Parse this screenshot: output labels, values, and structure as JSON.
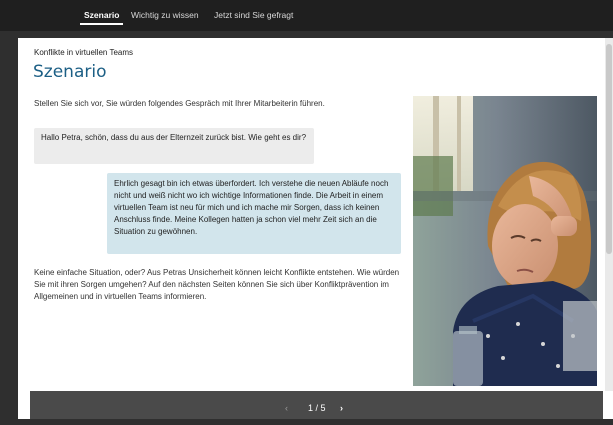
{
  "nav": {
    "tabs": [
      {
        "label": "Szenario",
        "active": true
      },
      {
        "label": "Wichtig zu wissen",
        "active": false
      },
      {
        "label": "Jetzt sind Sie gefragt",
        "active": false
      }
    ]
  },
  "page": {
    "kicker": "Konflikte in virtuellen Teams",
    "title": "Szenario",
    "intro": "Stellen Sie sich vor, Sie würden folgendes Gespräch mit Ihrer Mitarbeiterin führen.",
    "bubble_manager": "Hallo Petra, schön, dass du aus der Elternzeit zurück bist. Wie geht es dir?",
    "bubble_petra": "Ehrlich gesagt bin ich etwas überfordert. Ich verstehe die neuen Abläufe noch nicht und weiß nicht wo ich wichtige Informationen finde. Die Arbeit in einem virtuellen Team ist neu für mich und ich mache mir Sorgen, dass ich keinen Anschluss finde. Meine Kollegen hatten ja schon viel mehr Zeit sich an die Situation zu gewöhnen.",
    "outro": "Keine einfache Situation, oder? Aus Petras Unsicherheit können leicht Konflikte entstehen. Wie würden Sie mit ihren Sorgen umgehen? Auf den nächsten Seiten können Sie sich über Konfliktprävention im Allgemeinen und in virtuellen Teams informieren."
  },
  "pager": {
    "prev_icon": "chevron-left-icon",
    "next_icon": "chevron-right-icon",
    "count": "1 / 5"
  },
  "colors": {
    "title": "#1c5f85",
    "bubble_manager_bg": "#ececec",
    "bubble_petra_bg": "#d2e5ec",
    "pager_bg": "#4a4a4a"
  }
}
